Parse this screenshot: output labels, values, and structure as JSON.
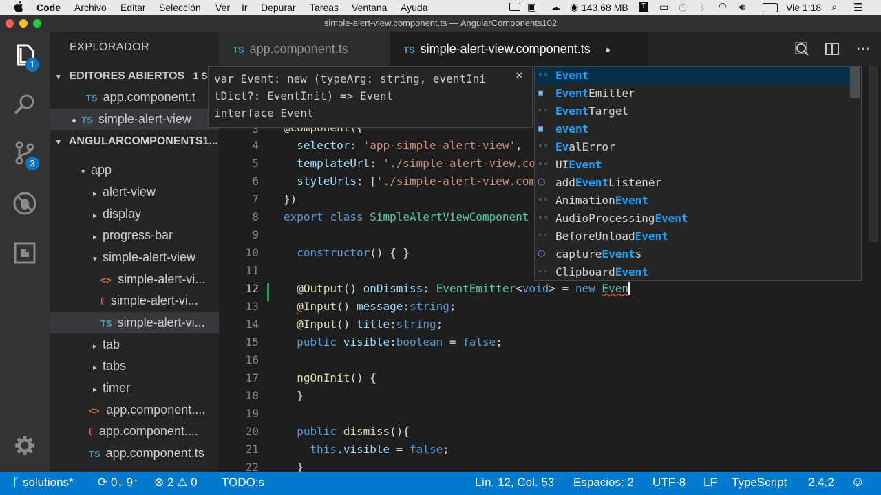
{
  "menubar": {
    "app_name": "Code",
    "items": [
      "Archivo",
      "Editar",
      "Selección",
      "Ver",
      "Ir",
      "Depurar",
      "Tareas",
      "Ventana",
      "Ayuda"
    ],
    "memory": "143.68 MB",
    "clock": "Vie 1:18"
  },
  "window": {
    "title": "simple-alert-view.component.ts — AngularComponents102"
  },
  "activity": {
    "explorer_badge": "1",
    "scm_badge": "3"
  },
  "sidebar": {
    "header": "EXPLORADOR",
    "open_editors": {
      "label": "EDITORES ABIERTOS",
      "count": "1 S"
    },
    "open_files": [
      {
        "icon": "TS",
        "name": "app.component.t"
      },
      {
        "icon": "TS",
        "name": "simple-alert-view"
      }
    ],
    "project": "ANGULARCOMPONENTS1...",
    "tree": [
      {
        "label": "app",
        "chev": "▾"
      },
      {
        "label": "alert-view",
        "chev": "▸"
      },
      {
        "label": "display",
        "chev": "▸"
      },
      {
        "label": "progress-bar",
        "chev": "▸"
      },
      {
        "label": "simple-alert-view",
        "chev": "▾"
      },
      {
        "label": "simple-alert-vi...",
        "icon": "<>"
      },
      {
        "label": "simple-alert-vi...",
        "icon": "css"
      },
      {
        "label": "simple-alert-vi...",
        "icon": "TS"
      },
      {
        "label": "tab",
        "chev": "▸"
      },
      {
        "label": "tabs",
        "chev": "▸"
      },
      {
        "label": "timer",
        "chev": "▸"
      },
      {
        "label": "app.component....",
        "icon": "<>"
      },
      {
        "label": "app.component....",
        "icon": "css"
      },
      {
        "label": "app.component.ts",
        "icon": "TS"
      }
    ]
  },
  "tabs": [
    {
      "icon": "TS",
      "label": "app.component.ts"
    },
    {
      "icon": "TS",
      "label": "simple-alert-view.component.ts",
      "dirty": "●"
    }
  ],
  "hover": {
    "lines": [
      "var Event: new (typeArg: string, eventIni",
      "tDict?: EventInit) => Event",
      "interface Event"
    ],
    "close": "×"
  },
  "suggest": {
    "items": [
      {
        "icon": "◦◦",
        "pre": "",
        "match": "Event",
        "post": ""
      },
      {
        "icon": "▣",
        "pre": "",
        "match": "Event",
        "post": "Emitter"
      },
      {
        "icon": "◦◦",
        "pre": "",
        "match": "Event",
        "post": "Target"
      },
      {
        "icon": "▣",
        "pre": "",
        "match": "event",
        "post": ""
      },
      {
        "icon": "◦◦",
        "pre": "",
        "match": "Ev",
        "post": "alError"
      },
      {
        "icon": "◦◦",
        "pre": "UI",
        "match": "Event",
        "post": ""
      },
      {
        "icon": "⬡",
        "pre": "add",
        "match": "Event",
        "post": "Listener"
      },
      {
        "icon": "◦◦",
        "pre": "Animation",
        "match": "Event",
        "post": ""
      },
      {
        "icon": "◦◦",
        "pre": "AudioProcessing",
        "match": "Event",
        "post": ""
      },
      {
        "icon": "◦◦",
        "pre": "BeforeUnload",
        "match": "Event",
        "post": ""
      },
      {
        "icon": "⬡",
        "pre": "capture",
        "match": "Event",
        "post": "s"
      },
      {
        "icon": "◦◦",
        "pre": "Clipboard",
        "match": "Event",
        "post": ""
      }
    ]
  },
  "editor": {
    "line_numbers": [
      "3",
      "4",
      "5",
      "6",
      "7",
      "8",
      "9",
      "10",
      "11",
      "12",
      "13",
      "14",
      "15",
      "16",
      "17",
      "18",
      "19",
      "20",
      "21",
      "22"
    ]
  },
  "status": {
    "branch": "solutions*",
    "sync": "0↓ 9↑",
    "errors": "2",
    "warnings": "0",
    "todo": "TODO:s",
    "position": "Lín. 12, Col. 53",
    "spaces": "Espacios: 2",
    "encoding": "UTF-8",
    "eol": "LF",
    "language": "TypeScript",
    "version": "2.4.2"
  }
}
